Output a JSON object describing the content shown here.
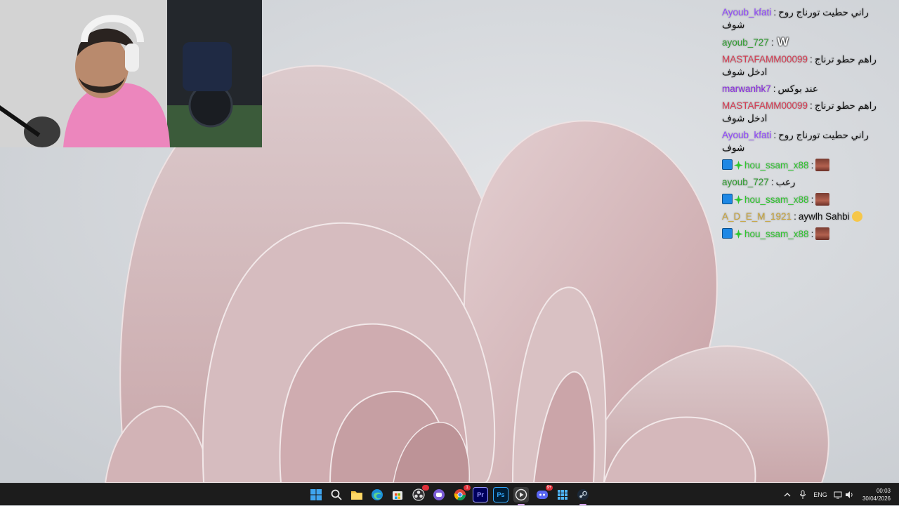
{
  "webcam": {
    "label": "Streamer webcam"
  },
  "chat": {
    "messages": [
      {
        "user": "Ayoub_kfati",
        "user_color": "#9147ff",
        "text": "راني حطيت تورناج روح شوف",
        "badges": [],
        "emote": ""
      },
      {
        "user": "ayoub_727",
        "user_color": "#2e9e2e",
        "text": "",
        "badges": [],
        "emote": "W"
      },
      {
        "user": "MASTAFAMM00099",
        "user_color": "#d63c52",
        "text": "راهم حطو ترناج ادخل شوف",
        "badges": [],
        "emote": ""
      },
      {
        "user": "marwanhk7",
        "user_color": "#8a2be2",
        "text": "عند بوكس",
        "badges": [],
        "emote": ""
      },
      {
        "user": "MASTAFAMM00099",
        "user_color": "#d63c52",
        "text": "راهم حطو ترناج ادخل شوف",
        "badges": [],
        "emote": ""
      },
      {
        "user": "Ayoub_kfati",
        "user_color": "#9147ff",
        "text": "راني حطيت تورناج روح شوف",
        "badges": [],
        "emote": ""
      },
      {
        "user": "hou_ssam_x88",
        "user_color": "#2ec72e",
        "text": "",
        "badges": [
          "badge-a",
          "badge-b"
        ],
        "emote": "face"
      },
      {
        "user": "ayoub_727",
        "user_color": "#2e9e2e",
        "text": "رعب",
        "badges": [],
        "emote": ""
      },
      {
        "user": "hou_ssam_x88",
        "user_color": "#2ec72e",
        "text": "",
        "badges": [
          "badge-a",
          "badge-b"
        ],
        "emote": "face"
      },
      {
        "user": "A_D_E_M_1921",
        "user_color": "#c8a43a",
        "text": "aywlh Sahbi",
        "badges": [],
        "emote": "emoji"
      },
      {
        "user": "hou_ssam_x88",
        "user_color": "#2ec72e",
        "text": "",
        "badges": [
          "badge-a",
          "badge-b"
        ],
        "emote": "face"
      }
    ]
  },
  "taskbar": {
    "apps": [
      {
        "name": "start-button",
        "icon": "windows-icon"
      },
      {
        "name": "search-button",
        "icon": "search-icon"
      },
      {
        "name": "file-explorer",
        "icon": "folder-icon"
      },
      {
        "name": "edge",
        "icon": "edge-icon"
      },
      {
        "name": "microsoft-store",
        "icon": "store-icon"
      },
      {
        "name": "obs",
        "icon": "obs-icon"
      },
      {
        "name": "messenger-app",
        "icon": "chat-app-icon"
      },
      {
        "name": "chrome",
        "icon": "chrome-icon",
        "badge": "1"
      },
      {
        "name": "premiere-pro",
        "icon": "premiere-icon",
        "label": "Pr"
      },
      {
        "name": "photoshop",
        "icon": "photoshop-icon",
        "label": "Ps"
      },
      {
        "name": "media-player",
        "icon": "play-icon",
        "active": true
      },
      {
        "name": "discord",
        "icon": "discord-icon",
        "badge": "9+"
      },
      {
        "name": "app-grid",
        "icon": "grid-icon"
      },
      {
        "name": "steam",
        "icon": "steam-icon"
      }
    ],
    "tray": {
      "language": "ENG",
      "time": "00:03",
      "date": "30/04/2026"
    }
  }
}
